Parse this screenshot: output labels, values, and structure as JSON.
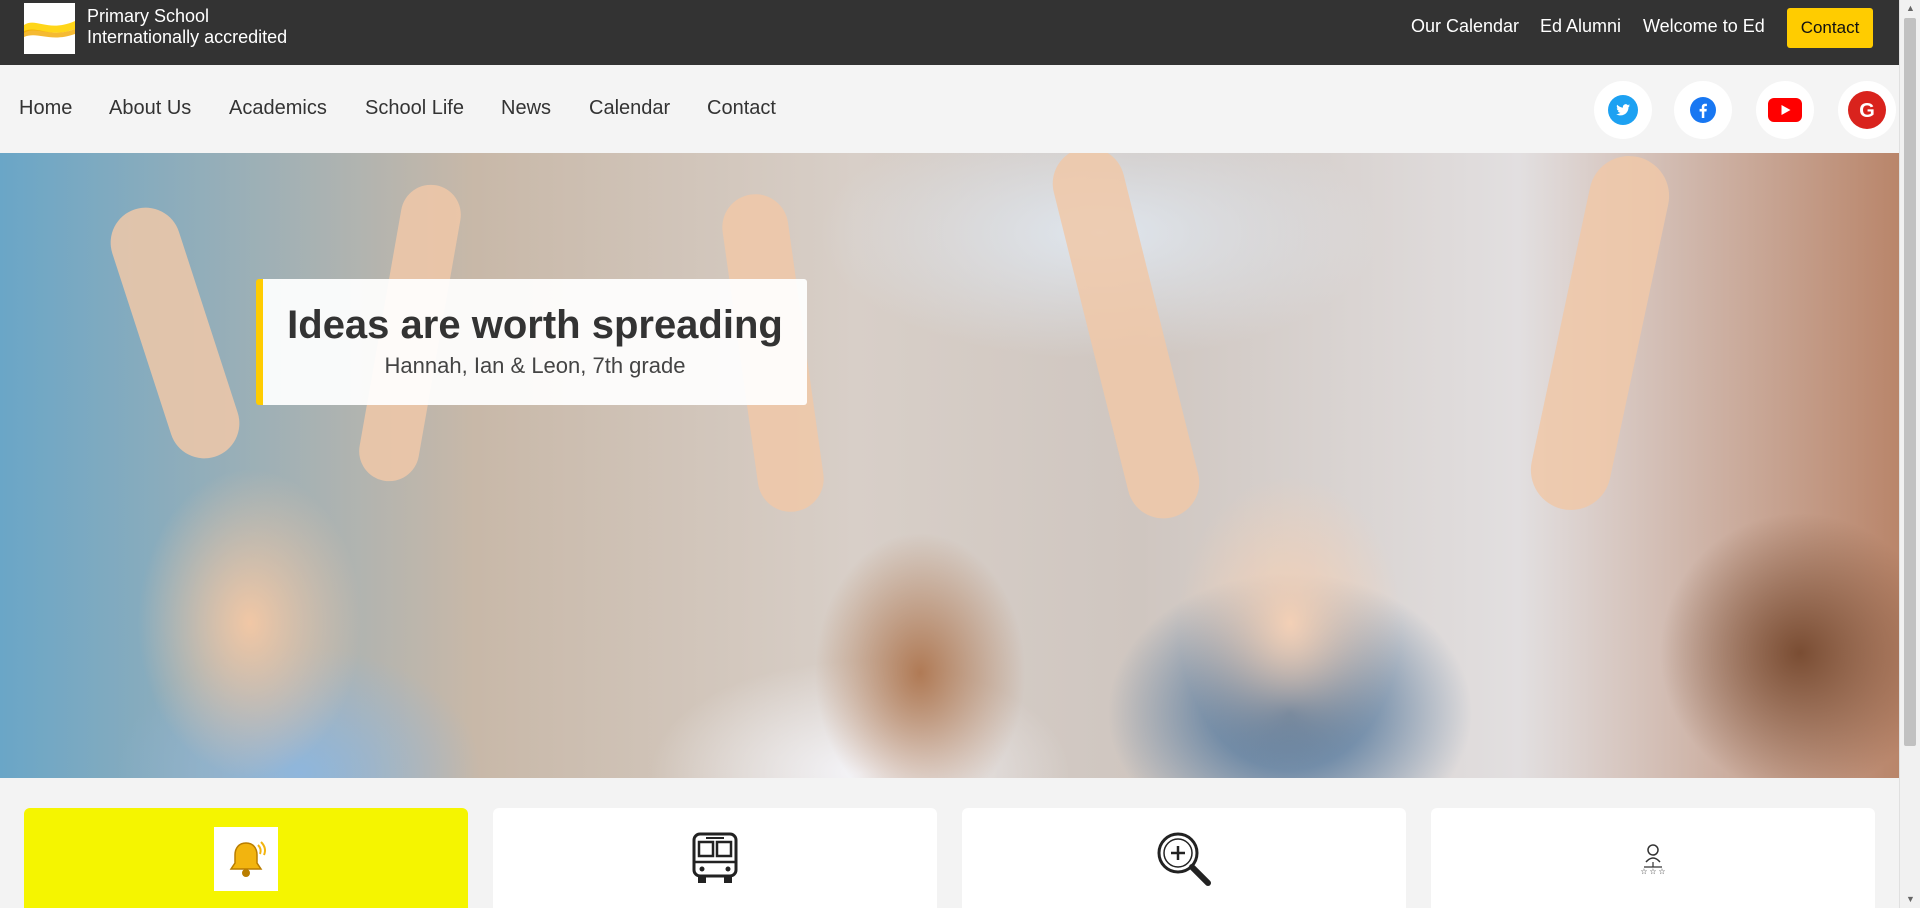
{
  "topbar": {
    "brand_line1": "Primary School",
    "brand_line2": "Internationally accredited",
    "links": [
      "Our Calendar",
      "Ed Alumni",
      "Welcome to Ed"
    ],
    "contact_button": "Contact",
    "accent": "#ffcc00",
    "background": "#333333"
  },
  "nav": {
    "items": [
      "Home",
      "About Us",
      "Academics",
      "School Life",
      "News",
      "Calendar",
      "Contact"
    ]
  },
  "social": [
    "twitter-icon",
    "facebook-icon",
    "youtube-icon",
    "google-icon"
  ],
  "hero": {
    "title": "Ideas are worth spreading",
    "subtitle": "Hannah, Ian & Leon, 7th grade"
  },
  "cards": [
    {
      "icon": "bell-icon",
      "active": true
    },
    {
      "icon": "bus-icon",
      "active": false
    },
    {
      "icon": "magnifier-plus-icon",
      "active": false
    },
    {
      "icon": "org-people-icon",
      "active": false
    }
  ]
}
